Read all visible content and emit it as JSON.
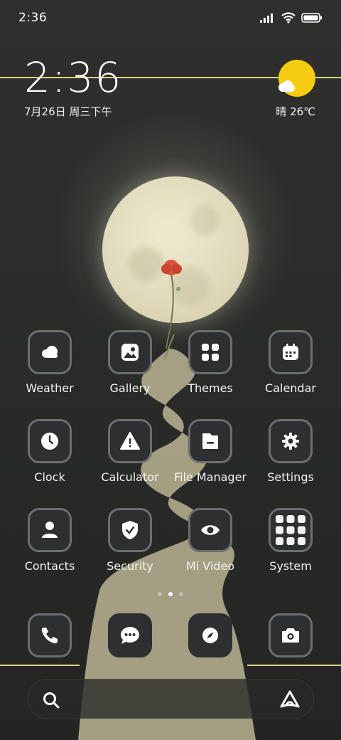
{
  "status_bar": {
    "time": "2:36"
  },
  "clock_widget": {
    "time": "2:36",
    "date": "7月26日 周三下午"
  },
  "weather_widget": {
    "text": "晴 26℃",
    "icon": "sun-cloud-icon"
  },
  "apps": [
    {
      "label": "Weather",
      "icon": "weather-icon"
    },
    {
      "label": "Gallery",
      "icon": "gallery-icon"
    },
    {
      "label": "Themes",
      "icon": "themes-icon"
    },
    {
      "label": "Calendar",
      "icon": "calendar-icon"
    },
    {
      "label": "Clock",
      "icon": "clock-icon"
    },
    {
      "label": "Calculator",
      "icon": "calculator-icon"
    },
    {
      "label": "File Manager",
      "icon": "file-manager-icon"
    },
    {
      "label": "Settings",
      "icon": "settings-icon"
    },
    {
      "label": "Contacts",
      "icon": "contacts-icon"
    },
    {
      "label": "Security",
      "icon": "security-icon"
    },
    {
      "label": "Mi Video",
      "icon": "mi-video-icon"
    },
    {
      "label": "System",
      "icon": "system-folder-icon"
    }
  ],
  "page_indicator": {
    "pages": 3,
    "active": 1
  },
  "dock": [
    {
      "icon": "phone-icon"
    },
    {
      "icon": "messages-icon"
    },
    {
      "icon": "browser-icon"
    },
    {
      "icon": "camera-icon"
    }
  ],
  "colors": {
    "accent_line": "#d9cf8a",
    "sun": "#f6cc12",
    "icon_bg": "#2e2f31"
  }
}
